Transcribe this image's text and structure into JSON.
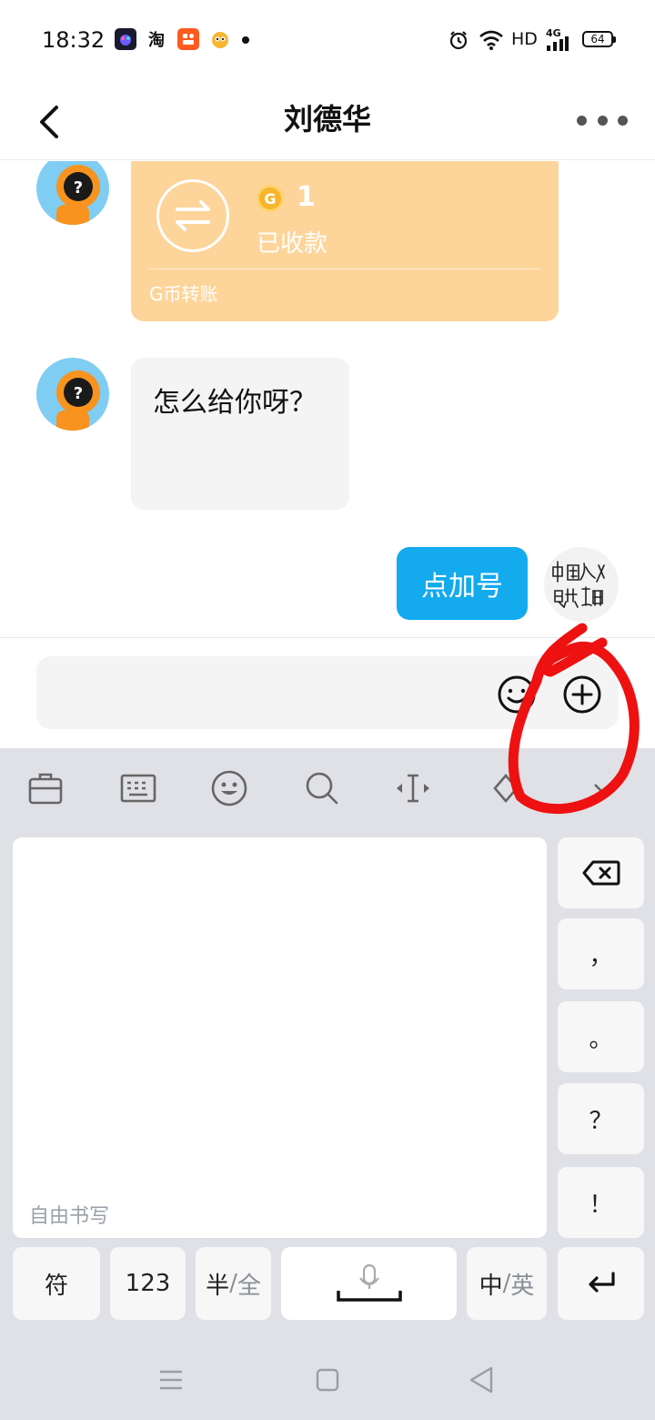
{
  "status_bar": {
    "time": "18:32",
    "apps": [
      "淘",
      "品"
    ],
    "network": "HD",
    "signal": "4G",
    "battery": "64"
  },
  "header": {
    "title": "刘德华"
  },
  "chat": {
    "transfer": {
      "amount": "1",
      "coin_symbol": "G",
      "status": "已收款",
      "footer": "G币转账"
    },
    "incoming_message": "怎么给你呀？",
    "outgoing_message": "点加号",
    "self_avatar_text": "中国人民共和国"
  },
  "input": {
    "value": "",
    "placeholder": ""
  },
  "keyboard": {
    "handwriting_hint": "自由书写",
    "side_keys": [
      "，",
      "。",
      "？",
      "！"
    ],
    "bottom_keys": {
      "symbols": "符",
      "numbers": "123",
      "half": "半",
      "full": "全",
      "chinese": "中",
      "english": "英"
    }
  },
  "colors": {
    "accent_blue": "#13aaee",
    "transfer_card": "#fdd59a",
    "annotation_red": "#ee1111"
  }
}
